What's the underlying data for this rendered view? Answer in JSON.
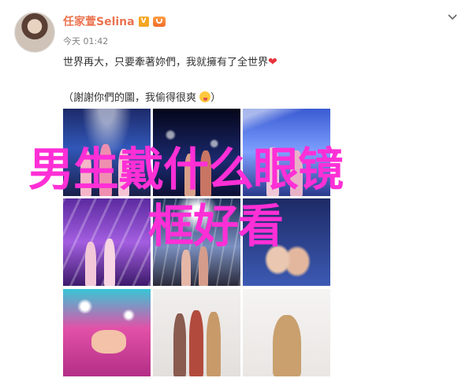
{
  "post": {
    "author": "任家萱Selina",
    "badge": "V",
    "meta": "今天 01:42",
    "text_line1": "世界再大，只要牽著妳們，我就擁有了全世界",
    "heart": "❤",
    "text_line2": "（謝謝你們的圖，我偷得很爽",
    "text_line2_end": "）"
  },
  "overlay": {
    "line1": "男生戴什么眼镜",
    "line2": "框好看"
  },
  "photos": [
    {
      "label": "stage-pink-dresses"
    },
    {
      "label": "stage-dark-confetti"
    },
    {
      "label": "stage-blue-light"
    },
    {
      "label": "stage-purple-beams"
    },
    {
      "label": "stage-spotlights"
    },
    {
      "label": "stage-holding-hands"
    },
    {
      "label": "pink-stage-hands"
    },
    {
      "label": "studio-three-women"
    },
    {
      "label": "studio-single-woman"
    }
  ],
  "icons": {
    "chevron": "chevron-down-icon",
    "vip": "vip-icon",
    "emoji": "grin-emoji-icon"
  },
  "colors": {
    "author": "#eb7350",
    "overlay": "#ff2fd6",
    "heart": "#e8333c"
  }
}
